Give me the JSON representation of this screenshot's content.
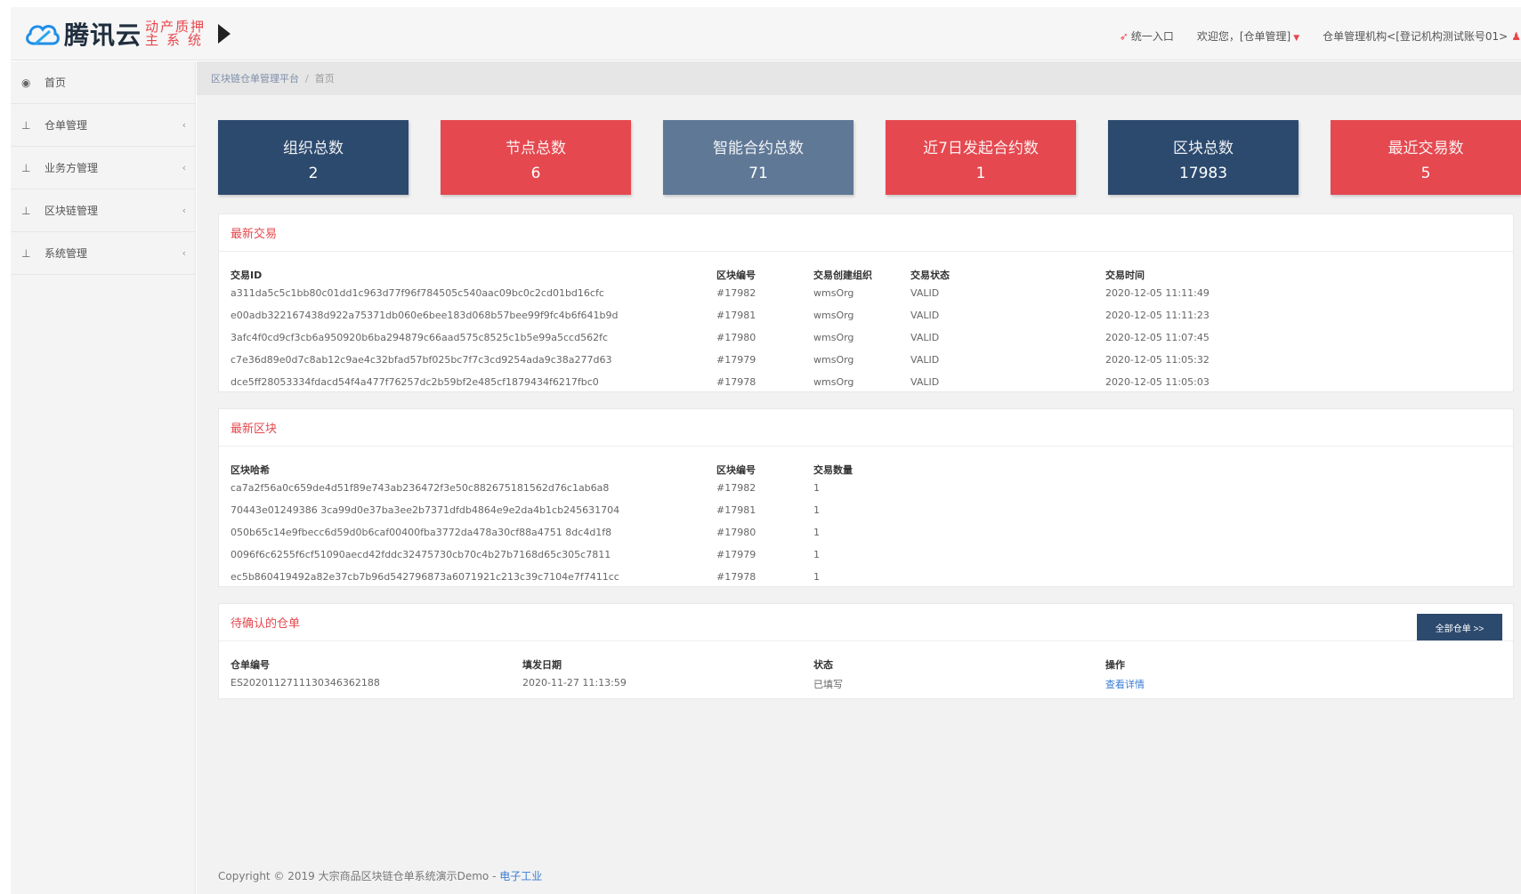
{
  "header": {
    "brand": "腾讯云",
    "sub_line1": "动产质押",
    "sub_line2": "主系统",
    "nav": {
      "entry": "统一入口",
      "welcome": "欢迎您，[仓单管理]",
      "org": "仓单管理机构<[登记机构测试账号01>"
    }
  },
  "sidebar": {
    "items": [
      {
        "label": "首页",
        "icon": "dashboard-icon"
      },
      {
        "label": "仓单管理",
        "icon": "sitemap-icon"
      },
      {
        "label": "业务方管理",
        "icon": "sitemap-icon"
      },
      {
        "label": "区块链管理",
        "icon": "sitemap-icon"
      },
      {
        "label": "系统管理",
        "icon": "sitemap-icon"
      }
    ]
  },
  "breadcrumb": {
    "root": "区块链仓单管理平台",
    "current": "首页"
  },
  "stats": [
    {
      "label": "组织总数",
      "value": "2",
      "color": "#2c4a6e"
    },
    {
      "label": "节点总数",
      "value": "6",
      "color": "#e5484f"
    },
    {
      "label": "智能合约总数",
      "value": "71",
      "color": "#5f7896"
    },
    {
      "label": "近7日发起合约数",
      "value": "1",
      "color": "#e5484f"
    },
    {
      "label": "区块总数",
      "value": "17983",
      "color": "#2c4a6e"
    },
    {
      "label": "最近交易数",
      "value": "5",
      "color": "#e5484f"
    }
  ],
  "latest_tx": {
    "title": "最新交易",
    "headers": [
      "交易ID",
      "区块编号",
      "交易创建组织",
      "交易状态",
      "交易时间"
    ],
    "rows": [
      [
        "a311da5c5c1bb80c01dd1c963d77f96f784505c540aac09bc0c2cd01bd16cfc",
        "#17982",
        "wmsOrg",
        "VALID",
        "2020-12-05 11:11:49"
      ],
      [
        "e00adb322167438d922a75371db060e6bee183d068b57bee99f9fc4b6f641b9d",
        "#17981",
        "wmsOrg",
        "VALID",
        "2020-12-05 11:11:23"
      ],
      [
        "3afc4f0cd9cf3cb6a950920b6ba294879c66aad575c8525c1b5e99a5ccd562fc",
        "#17980",
        "wmsOrg",
        "VALID",
        "2020-12-05 11:07:45"
      ],
      [
        "c7e36d89e0d7c8ab12c9ae4c32bfad57bf025bc7f7c3cd9254ada9c38a277d63",
        "#17979",
        "wmsOrg",
        "VALID",
        "2020-12-05 11:05:32"
      ],
      [
        "dce5ff28053334fdacd54f4a477f76257dc2b59bf2e485cf1879434f6217fbc0",
        "#17978",
        "wmsOrg",
        "VALID",
        "2020-12-05 11:05:03"
      ]
    ]
  },
  "latest_blocks": {
    "title": "最新区块",
    "headers": [
      "区块哈希",
      "区块编号",
      "交易数量"
    ],
    "rows": [
      [
        "ca7a2f56a0c659de4d51f89e743ab236472f3e50c882675181562d76c1ab6a8",
        "#17982",
        "1"
      ],
      [
        "70443e01249386 3ca99d0e37ba3ee2b7371dfdb4864e9e2da4b1cb245631704",
        "#17981",
        "1"
      ],
      [
        "050b65c14e9fbecc6d59d0b6caf00400fba3772da478a30cf88a4751 8dc4d1f8",
        "#17980",
        "1"
      ],
      [
        "0096f6c6255f6cf51090aecd42fddc32475730cb70c4b27b7168d65c305c7811",
        "#17979",
        "1"
      ],
      [
        "ec5b860419492a82e37cb7b96d542796873a6071921c213c39c7104e7f7411cc",
        "#17978",
        "1"
      ]
    ]
  },
  "pending": {
    "title": "待确认的仓单",
    "more": "全部仓单 >>",
    "headers": [
      "仓单编号",
      "填发日期",
      "状态",
      "操作"
    ],
    "rows": [
      [
        "ES2020112711130346362188",
        "2020-11-27 11:13:59",
        "已填写",
        "查看详情"
      ]
    ]
  },
  "footer": {
    "text": "Copyright © 2019 大宗商品区块链仓单系统演示Demo -",
    "link": "电子工业"
  }
}
